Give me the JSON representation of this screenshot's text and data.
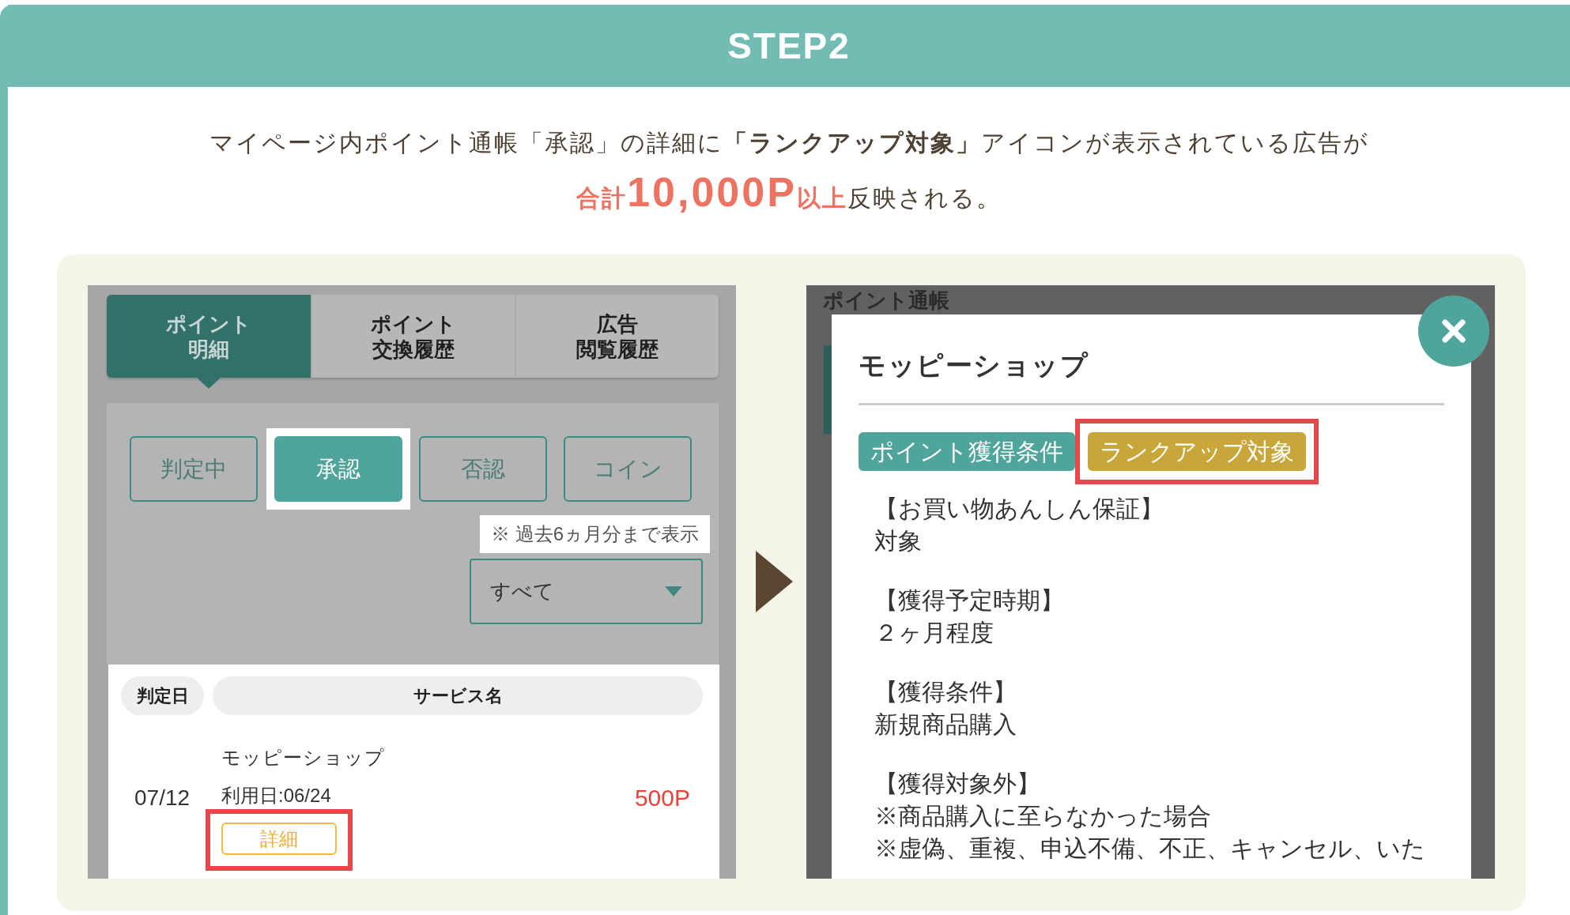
{
  "header": {
    "title": "STEP2"
  },
  "instruction": {
    "line_1": "マイページ内ポイント通帳「承認」の詳細に**「ランクアップ対象」**アイコンが表示されている広告が",
    "line_2": {
      "prefix": "合計",
      "amount": "10,000P",
      "suffix": "以上",
      "rest": "反映される。"
    }
  },
  "left_screen": {
    "tabs": [
      {
        "lines": [
          "ポイント",
          "明細"
        ],
        "selected": true
      },
      {
        "lines": [
          "ポイント",
          "交換履歴"
        ],
        "selected": false
      },
      {
        "lines": [
          "広告",
          "閲覧履歴"
        ],
        "selected": false
      }
    ],
    "filters": [
      {
        "label": "判定中",
        "selected": false,
        "highlighted": false
      },
      {
        "label": "承認",
        "selected": true,
        "highlighted": true
      },
      {
        "label": "否認",
        "selected": false,
        "highlighted": false
      },
      {
        "label": "コイン",
        "selected": false,
        "highlighted": false
      }
    ],
    "note": "※ 過去6ヵ月分まで表示",
    "dropdown": {
      "value": "すべて"
    },
    "table": {
      "columns": [
        "判定日",
        "サービス名"
      ],
      "rows": [
        {
          "date": "07/12",
          "service": "モッピーショップ",
          "usage_date": "利用日:06/24",
          "points": "500P",
          "detail_button": {
            "label": "詳細",
            "highlighted": true
          }
        }
      ]
    }
  },
  "right_screen": {
    "background_title": "ポイント通帳",
    "modal": {
      "title": "モッピーショップ",
      "badges": [
        {
          "label": "ポイント獲得条件",
          "color": "#4fa59c",
          "highlighted": false
        },
        {
          "label": "ランクアップ対象",
          "color": "#c9a63a",
          "highlighted": true
        }
      ],
      "sections": [
        {
          "heading": "【お買い物あんしん保証】",
          "lines": [
            "対象"
          ]
        },
        {
          "heading": "【獲得予定時期】",
          "lines": [
            "２ヶ月程度"
          ]
        },
        {
          "heading": "【獲得条件】",
          "lines": [
            "新規商品購入"
          ]
        },
        {
          "heading": "【獲得対象外】",
          "lines": [
            "※商品購入に至らなかった場合",
            "※虚偽、重複、申込不備、不正、キャンセル、いた"
          ]
        }
      ]
    }
  }
}
